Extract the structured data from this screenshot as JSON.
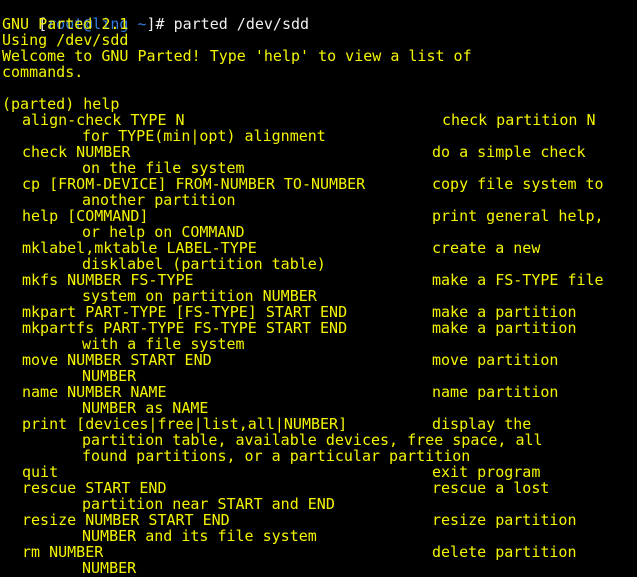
{
  "colors": {
    "background": "#000000",
    "output_text": "#f5f500",
    "prompt_bracket": "#f0f0f0",
    "prompt_user": "#2f7de1"
  },
  "prompt": {
    "open": "[",
    "userhost": "root@ling",
    "cwd": " ~",
    "close": "]# ",
    "command": "parted /dev/sdd"
  },
  "banner": {
    "version": "GNU Parted 2.1",
    "using": "Using /dev/sdd",
    "welcome1": "Welcome to GNU Parted! Type 'help' to view a list of",
    "welcome2": "commands."
  },
  "parted_prompt": "(parted) help",
  "help": [
    {
      "cmd": "align-check TYPE N",
      "desc": "check partition N",
      "cont": "for TYPE(min|opt) alignment"
    },
    {
      "cmd": "check NUMBER",
      "desc": "do a simple check",
      "cont": "on the file system"
    },
    {
      "cmd": "cp [FROM-DEVICE] FROM-NUMBER TO-NUMBER",
      "desc": "copy file system to",
      "cont": "another partition"
    },
    {
      "cmd": "help [COMMAND]",
      "desc": "print general help,",
      "cont": "or help on COMMAND"
    },
    {
      "cmd": "mklabel,mktable LABEL-TYPE",
      "desc": "create a new",
      "cont": "disklabel (partition table)"
    },
    {
      "cmd": "mkfs NUMBER FS-TYPE",
      "desc": "make a FS-TYPE file",
      "cont": "system on partition NUMBER"
    },
    {
      "cmd": "mkpart PART-TYPE [FS-TYPE] START END",
      "desc": "make a partition"
    },
    {
      "cmd": "mkpartfs PART-TYPE FS-TYPE START END",
      "desc": "make a partition",
      "cont": "with a file system"
    },
    {
      "cmd": "move NUMBER START END",
      "desc": "move partition",
      "cont": "NUMBER"
    },
    {
      "cmd": "name NUMBER NAME",
      "desc": "name partition",
      "cont": "NUMBER as NAME"
    },
    {
      "cmd": "print [devices|free|list,all|NUMBER]",
      "desc": "display the",
      "cont": "partition table, available devices, free space, all",
      "cont2": "found partitions, or a particular partition"
    },
    {
      "cmd": "quit",
      "desc": "exit program"
    },
    {
      "cmd": "rescue START END",
      "desc": "rescue a lost",
      "cont": "partition near START and END"
    },
    {
      "cmd": "resize NUMBER START END",
      "desc": "resize partition",
      "cont": "NUMBER and its file system"
    },
    {
      "cmd": "rm NUMBER",
      "desc": "delete partition",
      "cont": "NUMBER"
    }
  ]
}
